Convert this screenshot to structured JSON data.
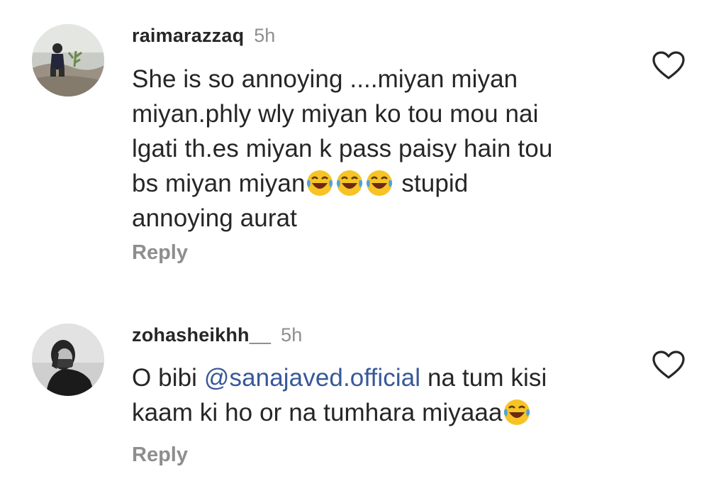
{
  "comments": [
    {
      "username": "raimarazzaq",
      "time": "5h",
      "lines": [
        "She is so annoying ....miyan miyan",
        "miyan.phly wly miyan ko tou mou nai",
        "lgati th.es miyan  k pass paisy hain tou"
      ],
      "line4_text": "bs miyan miyan",
      "line4_emoji": "😂😂😂",
      "line4_after": " stupid",
      "line5": "annoying aurat",
      "reply_label": "Reply",
      "like_icon": "heart-outline-icon"
    },
    {
      "username": "zohasheikhh__",
      "time": "5h",
      "prefix": "O bibi ",
      "mention": "@sanajaved.official",
      "suffix": " na tum kisi",
      "line2": "kaam ki ho or na tumhara miyaaa",
      "line2_emoji": "😂",
      "reply_label": "Reply",
      "like_icon": "heart-outline-icon"
    }
  ]
}
